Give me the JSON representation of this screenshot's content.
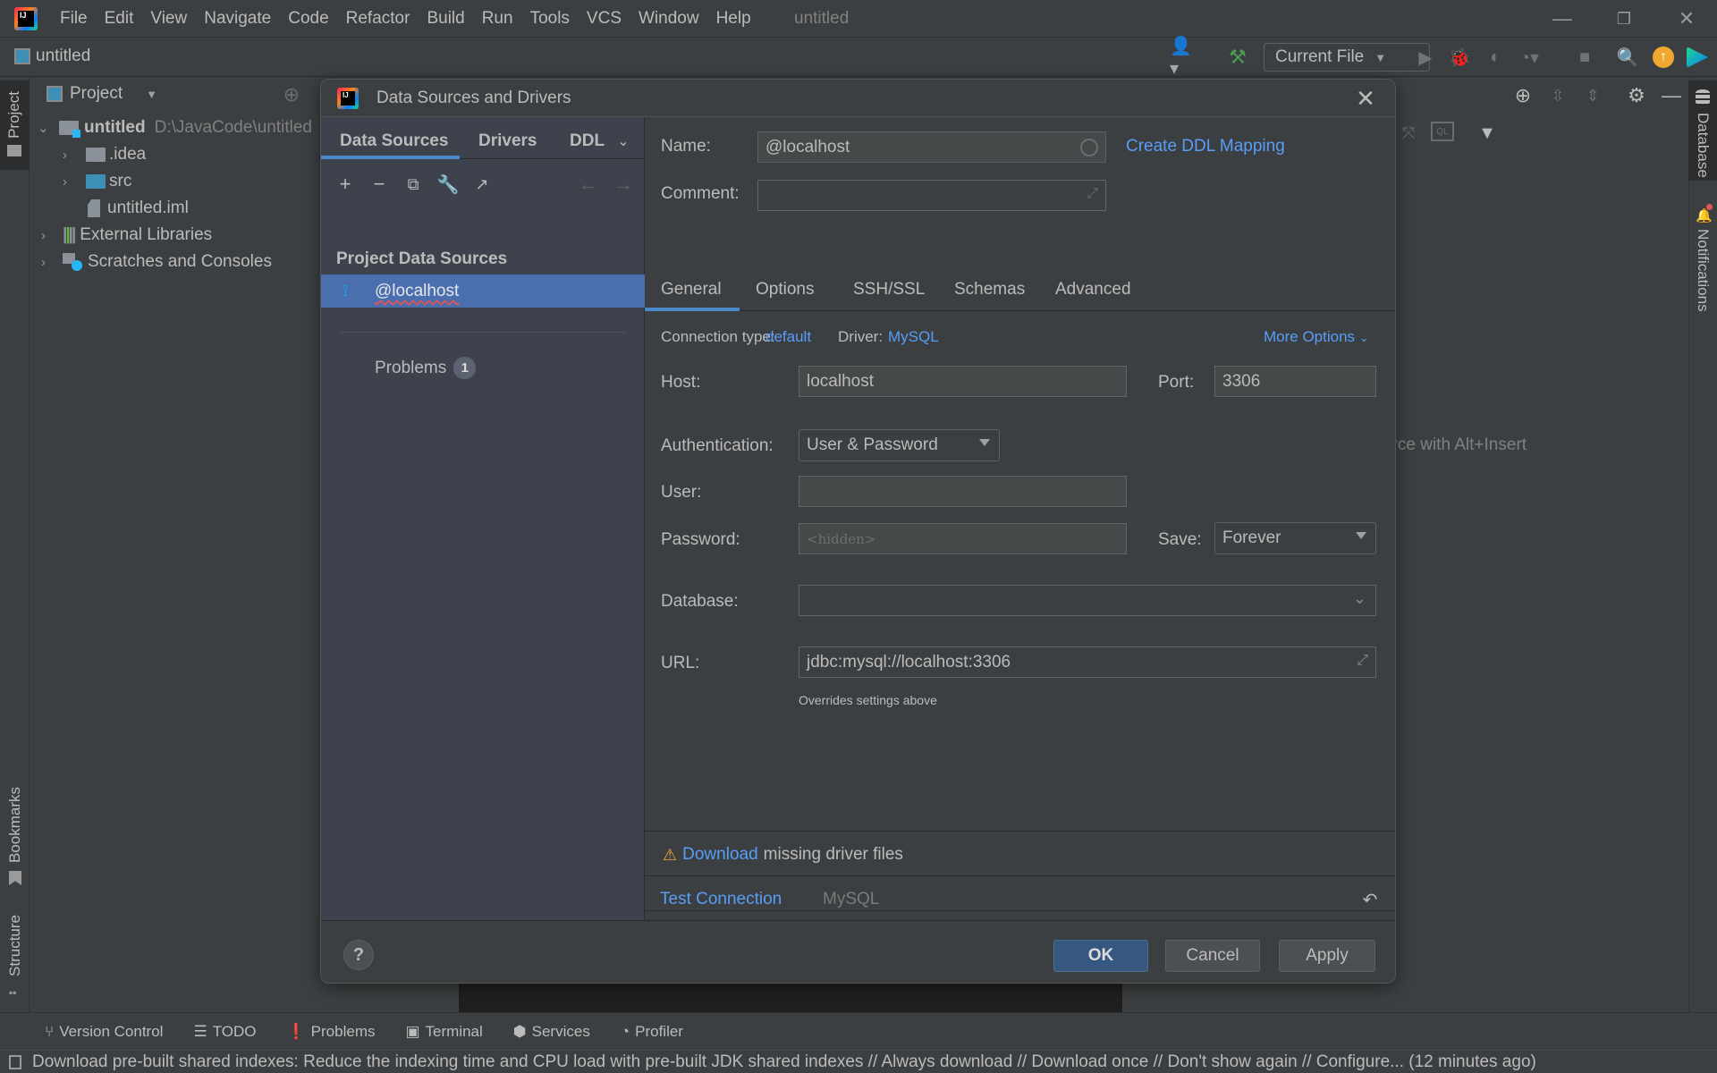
{
  "app": {
    "menu": [
      "File",
      "Edit",
      "View",
      "Navigate",
      "Code",
      "Refactor",
      "Build",
      "Run",
      "Tools",
      "VCS",
      "Window",
      "Help"
    ],
    "window_title": "untitled",
    "project_crumb": "untitled"
  },
  "toolbar": {
    "run_config": "Current File"
  },
  "left_stripe": {
    "project_tab": "Project",
    "bookmarks_tab": "Bookmarks",
    "structure_tab": "Structure"
  },
  "project_panel": {
    "title": "Project",
    "tree": [
      {
        "label": "untitled",
        "path": "D:\\JavaCode\\untitled"
      },
      {
        "label": ".idea"
      },
      {
        "label": "src"
      },
      {
        "label": "untitled.iml"
      },
      {
        "label": "External Libraries"
      },
      {
        "label": "Scratches and Consoles"
      }
    ]
  },
  "right_stripe": {
    "database_tab": "Database",
    "notifications_tab": "Notifications"
  },
  "database_panel": {
    "hint": "urce with Alt+Insert"
  },
  "dialog": {
    "title": "Data Sources and Drivers",
    "left_tabs": [
      "Data Sources",
      "Drivers",
      "DDL"
    ],
    "section_title": "Project Data Sources",
    "data_source": "@localhost",
    "problems_label": "Problems",
    "problems_count": "1",
    "name_label": "Name:",
    "name_value": "@localhost",
    "comment_label": "Comment:",
    "comment_value": "",
    "create_ddl_link": "Create DDL Mapping",
    "tabs": [
      "General",
      "Options",
      "SSH/SSL",
      "Schemas",
      "Advanced"
    ],
    "connection_type_label": "Connection type:",
    "connection_type_value": "default",
    "driver_label": "Driver:",
    "driver_value": "MySQL",
    "more_options": "More Options",
    "host_label": "Host:",
    "host_value": "localhost",
    "port_label": "Port:",
    "port_value": "3306",
    "auth_label": "Authentication:",
    "auth_value": "User & Password",
    "user_label": "User:",
    "user_value": "",
    "password_label": "Password:",
    "password_placeholder": "<hidden>",
    "save_label": "Save:",
    "save_value": "Forever",
    "database_label": "Database:",
    "database_value": "",
    "url_label": "URL:",
    "url_value": "jdbc:mysql://localhost:3306",
    "url_hint": "Overrides settings above",
    "download_link": "Download",
    "download_text": "missing driver files",
    "test_connection": "Test Connection",
    "driver_footer": "MySQL",
    "ok": "OK",
    "cancel": "Cancel",
    "apply": "Apply",
    "help": "?"
  },
  "bottom_tabs": [
    "Version Control",
    "TODO",
    "Problems",
    "Terminal",
    "Services",
    "Profiler"
  ],
  "status": {
    "message": "Download pre-built shared indexes: Reduce the indexing time and CPU load with pre-built JDK shared indexes // Always download // Download once // Don't show again // Configure... (12 minutes ago)"
  },
  "colors": {
    "accent": "#4a88c7",
    "link": "#589df6",
    "selection": "#4b6eaf",
    "primary_button": "#365880",
    "warning": "#f0a732"
  }
}
